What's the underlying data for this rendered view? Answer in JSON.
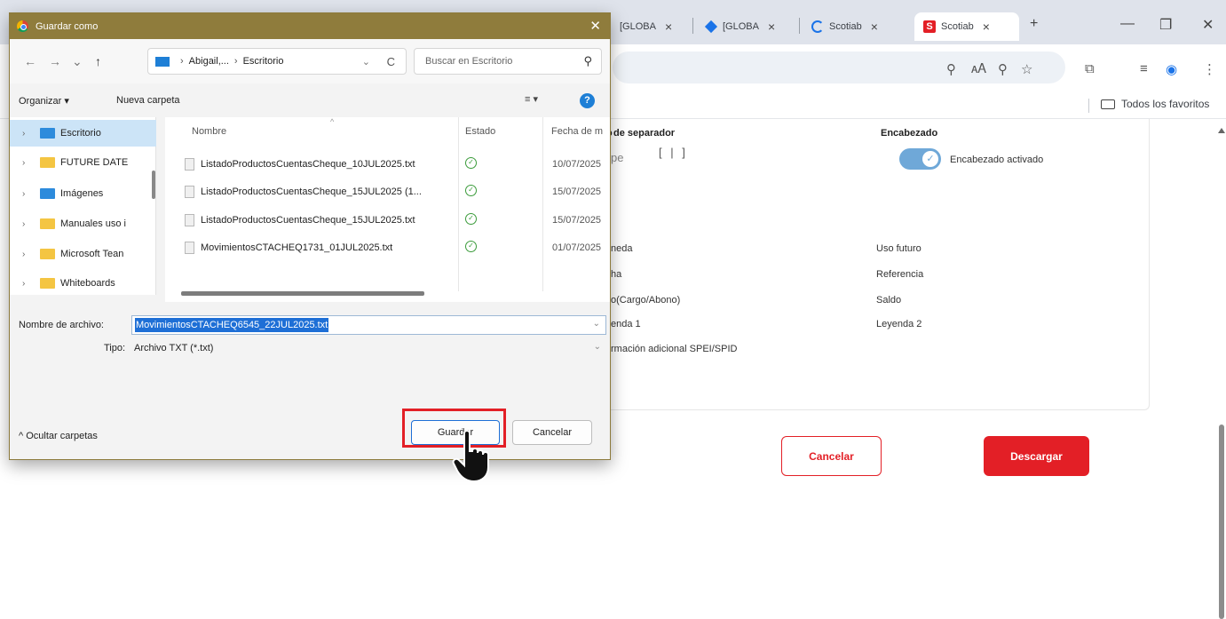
{
  "browser": {
    "tabs": [
      {
        "label": "[GLOBA",
        "close": "×",
        "favicon": "none"
      },
      {
        "label": "[GLOBA",
        "close": "×",
        "favicon": "diamond-icon"
      },
      {
        "label": "Scotiab",
        "close": "×",
        "favicon": "loading-icon"
      },
      {
        "label": "Scotiab",
        "close": "×",
        "favicon": "scotiabank-icon",
        "active": true
      }
    ],
    "new_tab": "+",
    "window_controls": {
      "minimize": "—",
      "restore": "❐",
      "close": "✕"
    },
    "bookmarks_folder": "Todos los favoritos",
    "toolbar_icons": [
      "location-icon",
      "translate-icon",
      "zoom-icon",
      "star-icon",
      "extensions-icon",
      "reading-list-icon",
      "profile-icon",
      "menu-icon"
    ]
  },
  "page": {
    "separator_label": "de separador",
    "separator_label_prefix": "o",
    "separator_left_frag": "pe",
    "separator_value": "[ | ]",
    "header_label": "Encabezado",
    "header_toggle_text": "Encabezado activado",
    "header_toggle_on": true,
    "fields_left": [
      "neda",
      "ha",
      "o(Cargo/Abono)",
      "enda 1",
      "rmación adicional SPEI/SPID"
    ],
    "fields_right": [
      "Uso futuro",
      "Referencia",
      "Saldo",
      "Leyenda 2"
    ],
    "cancel_button": "Cancelar",
    "download_button": "Descargar",
    "accent_color": "#e31f26"
  },
  "dialog": {
    "title": "Guardar como",
    "close": "✕",
    "nav": {
      "back": "←",
      "forward": "→",
      "recent": "⌄",
      "up": "↑",
      "refresh": "C"
    },
    "path": {
      "seg1": "Abigail,...",
      "seg2": "Escritorio",
      "chev": "›"
    },
    "search_placeholder": "Buscar en Escritorio",
    "organize": "Organizar ▾",
    "new_folder": "Nueva carpeta",
    "view_icon": "≡ ▾",
    "help": "?",
    "nav_items": [
      {
        "label": "Escritorio",
        "icon": "desktop-icon",
        "selected": true
      },
      {
        "label": "FUTURE DATE",
        "icon": "folder-icon"
      },
      {
        "label": "Imágenes",
        "icon": "pictures-icon"
      },
      {
        "label": "Manuales uso i",
        "icon": "folder-icon"
      },
      {
        "label": "Microsoft Tean",
        "icon": "folder-icon"
      },
      {
        "label": "Whiteboards",
        "icon": "folder-icon"
      }
    ],
    "columns": {
      "name": "Nombre",
      "status": "Estado",
      "date": "Fecha de m"
    },
    "files": [
      {
        "name": "ListadoProductosCuentasCheque_10JUL2025.txt",
        "date": "10/07/2025"
      },
      {
        "name": "ListadoProductosCuentasCheque_15JUL2025 (1...",
        "date": "15/07/2025"
      },
      {
        "name": "ListadoProductosCuentasCheque_15JUL2025.txt",
        "date": "15/07/2025"
      },
      {
        "name": "MovimientosCTACHEQ1731_01JUL2025.txt",
        "date": "01/07/2025"
      }
    ],
    "filename_label": "Nombre de archivo:",
    "filename_value": "MovimientosCTACHEQ6545_22JUL2025.txt",
    "type_label": "Tipo:",
    "type_value": "Archivo TXT (*.txt)",
    "hide_folders": "^ Ocultar carpetas",
    "save_button": "Guardar",
    "cancel_button": "Cancelar"
  }
}
